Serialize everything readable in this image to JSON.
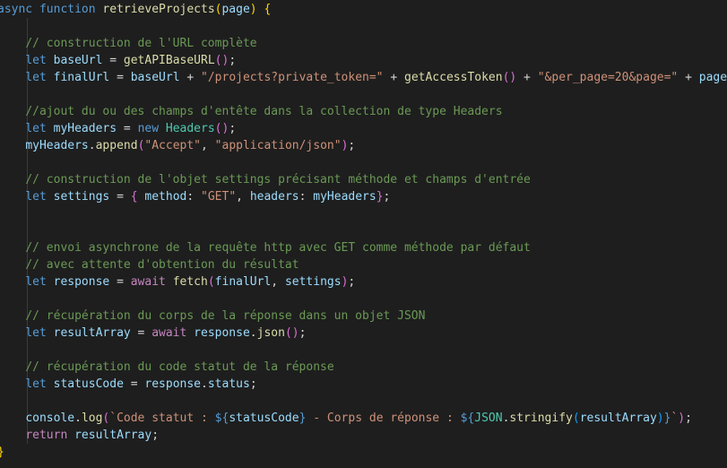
{
  "code": {
    "l1": {
      "t1": "async",
      "t2": " ",
      "t3": "function",
      "t4": " ",
      "t5": "retrieveProjects",
      "t6": "(",
      "t7": "page",
      "t8": ")",
      "t9": " ",
      "t10": "{"
    },
    "l3": {
      "t1": "    ",
      "t2": "// construction de l'URL complète"
    },
    "l4": {
      "t1": "    ",
      "t2": "let",
      "t3": " ",
      "t4": "baseUrl",
      "t5": " = ",
      "t6": "getAPIBaseURL",
      "t7": "()",
      "t8": ";"
    },
    "l5": {
      "t1": "    ",
      "t2": "let",
      "t3": " ",
      "t4": "finalUrl",
      "t5": " = ",
      "t6": "baseUrl",
      "t7": " + ",
      "t8": "\"/projects?private_token=\"",
      "t9": " + ",
      "t10": "getAccessToken",
      "t11": "()",
      "t12": " + ",
      "t13": "\"&per_page=20&page=\"",
      "t14": " + ",
      "t15": "page",
      "t16": ";"
    },
    "l7": {
      "t1": "    ",
      "t2": "//ajout du ou des champs d'entête dans la collection de type Headers"
    },
    "l8": {
      "t1": "    ",
      "t2": "let",
      "t3": " ",
      "t4": "myHeaders",
      "t5": " = ",
      "t6": "new",
      "t7": " ",
      "t8": "Headers",
      "t9": "()",
      "t10": ";"
    },
    "l9": {
      "t1": "    ",
      "t2": "myHeaders",
      "t3": ".",
      "t4": "append",
      "t5": "(",
      "t6": "\"Accept\"",
      "t7": ", ",
      "t8": "\"application/json\"",
      "t9": ")",
      "t10": ";"
    },
    "l11": {
      "t1": "    ",
      "t2": "// construction de l'objet settings précisant méthode et champs d'entrée"
    },
    "l12": {
      "t1": "    ",
      "t2": "let",
      "t3": " ",
      "t4": "settings",
      "t5": " = ",
      "t6": "{",
      "t7": " ",
      "t8": "method",
      "t9": ": ",
      "t10": "\"GET\"",
      "t11": ", ",
      "t12": "headers",
      "t13": ": ",
      "t14": "myHeaders",
      "t15": "}",
      "t16": ";"
    },
    "l15": {
      "t1": "    ",
      "t2": "// envoi asynchrone de la requête http avec GET comme méthode par défaut"
    },
    "l16": {
      "t1": "    ",
      "t2": "// avec attente d'obtention du résultat"
    },
    "l17": {
      "t1": "    ",
      "t2": "let",
      "t3": " ",
      "t4": "response",
      "t5": " = ",
      "t6": "await",
      "t7": " ",
      "t8": "fetch",
      "t9": "(",
      "t10": "finalUrl",
      "t11": ", ",
      "t12": "settings",
      "t13": ")",
      "t14": ";"
    },
    "l19": {
      "t1": "    ",
      "t2": "// récupération du corps de la réponse dans un objet JSON"
    },
    "l20": {
      "t1": "    ",
      "t2": "let",
      "t3": " ",
      "t4": "resultArray",
      "t5": " = ",
      "t6": "await",
      "t7": " ",
      "t8": "response",
      "t9": ".",
      "t10": "json",
      "t11": "()",
      "t12": ";"
    },
    "l22": {
      "t1": "    ",
      "t2": "// récupération du code statut de la réponse"
    },
    "l23": {
      "t1": "    ",
      "t2": "let",
      "t3": " ",
      "t4": "statusCode",
      "t5": " = ",
      "t6": "response",
      "t7": ".",
      "t8": "status",
      "t9": ";"
    },
    "l25": {
      "t1": "    ",
      "t2": "console",
      "t3": ".",
      "t4": "log",
      "t5": "(",
      "t6": "`Code statut : ",
      "t7": "${",
      "t8": "statusCode",
      "t9": "}",
      "t10": " - Corps de réponse : ",
      "t11": "${",
      "t12": "JSON",
      "t13": ".",
      "t14": "stringify",
      "t15": "(",
      "t16": "resultArray",
      "t17": ")",
      "t18": "}",
      "t19": "`",
      "t20": ")",
      "t21": ";"
    },
    "l26": {
      "t1": "    ",
      "t2": "return",
      "t3": " ",
      "t4": "resultArray",
      "t5": ";"
    },
    "l27": {
      "t1": "}"
    }
  },
  "colors": {
    "background": "#1e1e1e",
    "keyword": "#569cd6",
    "control": "#c586c0",
    "function": "#dcdcaa",
    "variable": "#9cdcfe",
    "class": "#4ec9b0",
    "string": "#ce9178",
    "comment": "#6a9955",
    "bracket_level1": "#ffd700",
    "bracket_level2": "#da70d6",
    "bracket_level3": "#179fff"
  }
}
